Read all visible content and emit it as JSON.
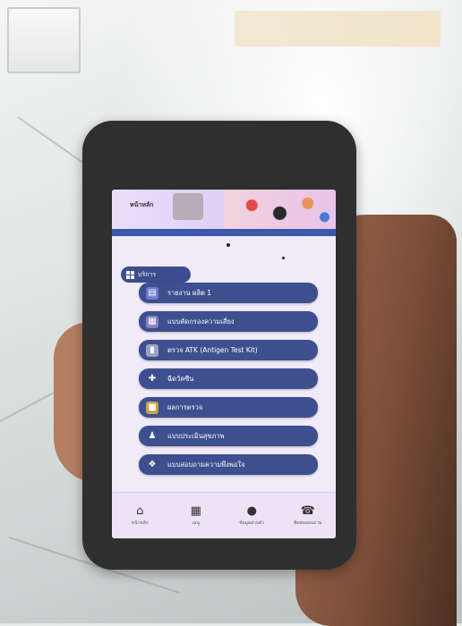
{
  "app": {
    "header_title": "หน้าหลัก",
    "section_label": "บริการ"
  },
  "menu": [
    {
      "label": "รายงาน ผลิต 1",
      "icon": "document-icon"
    },
    {
      "label": "แบบคัดกรองความเสี่ยง",
      "icon": "clipboard-icon"
    },
    {
      "label": "ตรวจ ATK (Antigen Test Kit)",
      "icon": "test-kit-icon"
    },
    {
      "label": "ฉีดวัคซีน",
      "icon": "vaccine-icon"
    },
    {
      "label": "ผลการตรวจ",
      "icon": "result-icon"
    },
    {
      "label": "แบบประเมินสุขภาพ",
      "icon": "person-check-icon"
    },
    {
      "label": "แบบสอบถามความพึงพอใจ",
      "icon": "survey-icon"
    }
  ],
  "nav": [
    {
      "label": "หน้าหลัก",
      "icon": "home-icon"
    },
    {
      "label": "เมนู",
      "icon": "grid-icon"
    },
    {
      "label": "ข้อมูลส่วนตัว",
      "icon": "user-icon"
    },
    {
      "label": "ติดต่อสอบถาม",
      "icon": "support-icon"
    }
  ]
}
